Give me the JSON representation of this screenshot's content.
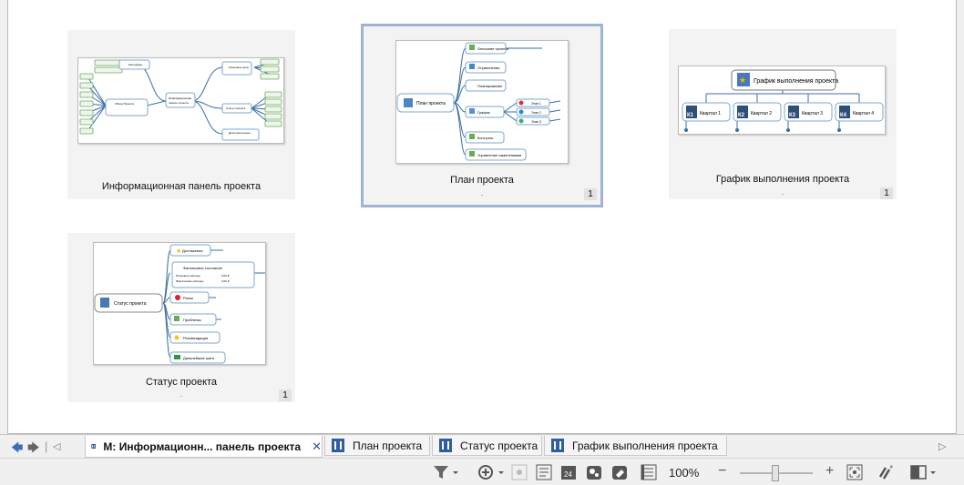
{
  "slides": [
    {
      "title": "Информационная панель проекта",
      "dot": "",
      "num": "",
      "thumb": {
        "center": "Информационная панель проекта",
        "top": "Календарь",
        "left": "Обзор Проекта",
        "right_a": "Ключевые даты",
        "right_b": "Статус проекта",
        "right_c": "Дополнительные документы"
      }
    },
    {
      "title": "План проекта",
      "dot": ".",
      "num": "1",
      "thumb": {
        "center": "План проекта",
        "items": [
          "Описание проекта",
          "Ограничения",
          "Планирование",
          "График",
          "Контроль",
          "Управление изменениями"
        ],
        "sub": [
          "Этап 1",
          "Этап 2",
          "Этап 3"
        ]
      }
    },
    {
      "title": "График выполнения проекта",
      "dot": ".",
      "num": "1",
      "thumb": {
        "center": "График выполнения проекта",
        "quarters": [
          {
            "tag": "К1",
            "label": "Квартал 1"
          },
          {
            "tag": "К2",
            "label": "Квартал 2"
          },
          {
            "tag": "К3",
            "label": "Квартал 3"
          },
          {
            "tag": "К4",
            "label": "Квартал 4"
          }
        ]
      }
    },
    {
      "title": "Статус проекта",
      "dot": ".",
      "num": "1",
      "thumb": {
        "center": "Статус проекта",
        "items": [
          "Достижения",
          "Финансовое состояние",
          "Риски",
          "Проблемы",
          "Рекомендации",
          "Дальнейшие шаги"
        ],
        "fin_a": "Плановые расходы",
        "fin_b": "Фактические расходы",
        "fin_val": "0,00 ₽"
      }
    }
  ],
  "tabs": [
    {
      "label": "М: Информационн... панель проекта",
      "close": "✕"
    },
    {
      "label": "План проекта"
    },
    {
      "label": "Статус проекта"
    },
    {
      "label": "График выполнения проекта"
    }
  ],
  "nav": {
    "back": "🡄",
    "forward": "🡆",
    "separator": "|",
    "left": "◁",
    "right": "▷"
  },
  "status": {
    "zoom": "100%",
    "minus": "−",
    "plus": "+"
  },
  "colors": {
    "accent": "#2b5aa0",
    "selected_border": "#9fb4d2",
    "topic_border": "#7fa7cf"
  }
}
